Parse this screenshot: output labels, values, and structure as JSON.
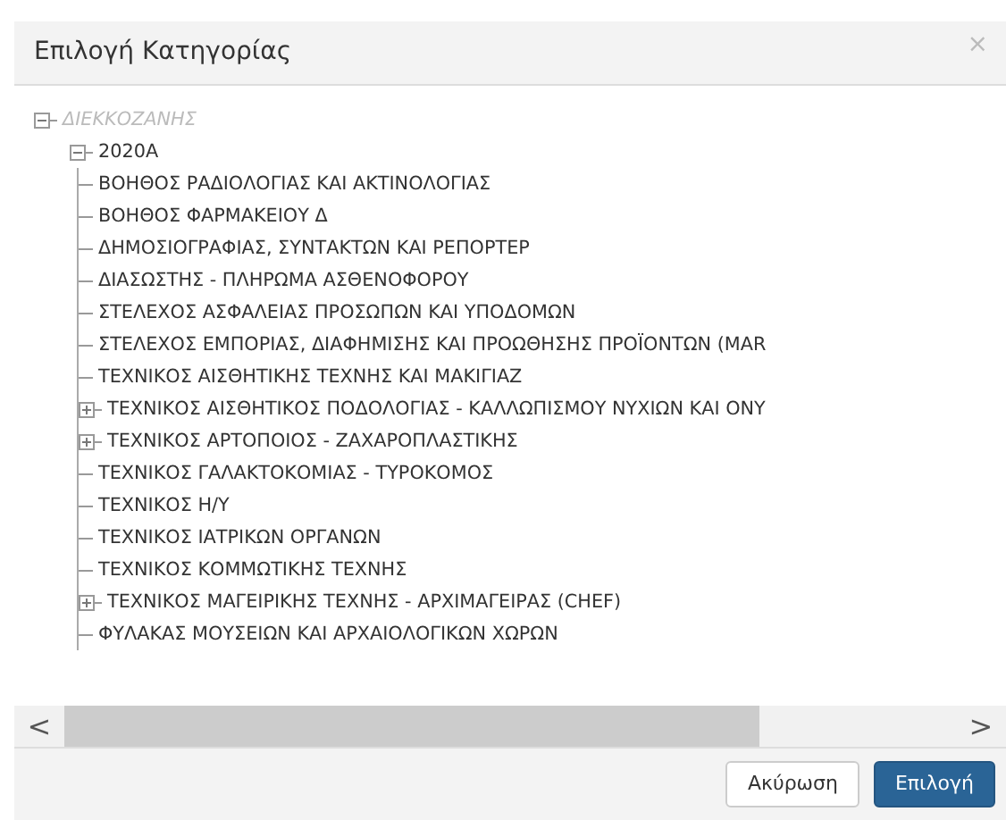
{
  "dialog": {
    "title": "Επιλογή Κατηγορίας",
    "close": "×"
  },
  "tree": [
    {
      "label": "ΔΙΕΚΚΟΖΑΝΗΣ",
      "disabled": true,
      "expanded": true,
      "children": [
        {
          "label": "2020A",
          "disabled": false,
          "expanded": true,
          "children": [
            {
              "label": "ΒΟΗΘΟΣ ΡΑΔΙΟΛΟΓΙΑΣ ΚΑΙ ΑΚΤΙΝΟΛΟΓΙΑΣ"
            },
            {
              "label": "ΒΟΗΘΟΣ ΦΑΡΜΑΚΕΙΟΥ Δ"
            },
            {
              "label": "ΔΗΜΟΣΙΟΓΡΑΦΙΑΣ, ΣΥΝΤΑΚΤΩΝ ΚΑΙ ΡΕΠΟΡΤΕΡ"
            },
            {
              "label": "ΔΙΑΣΩΣΤΗΣ - ΠΛΗΡΩΜΑ ΑΣΘΕΝΟΦΟΡΟΥ"
            },
            {
              "label": "ΣΤΕΛΕΧΟΣ ΑΣΦΑΛΕΙΑΣ ΠΡΟΣΩΠΩΝ ΚΑΙ ΥΠΟΔΟΜΩΝ"
            },
            {
              "label": "ΣΤΕΛΕΧΟΣ ΕΜΠΟΡΙΑΣ, ΔΙΑΦΗΜΙΣΗΣ ΚΑΙ ΠΡΟΩΘΗΣΗΣ ΠΡΟΪΟΝΤΩΝ (MAR"
            },
            {
              "label": "ΤΕΧΝΙΚΟΣ ΑΙΣΘΗΤΙΚΗΣ ΤΕΧΝΗΣ ΚΑΙ ΜΑΚΙΓΙΑΖ"
            },
            {
              "label": "ΤΕΧΝΙΚΟΣ ΑΙΣΘΗΤΙΚΟΣ ΠΟΔΟΛΟΓΙΑΣ - ΚΑΛΛΩΠΙΣΜΟΥ ΝΥΧΙΩΝ ΚΑΙ ΟΝΥ",
              "expanded": false
            },
            {
              "label": "ΤΕΧΝΙΚΟΣ ΑΡΤΟΠΟΙΟΣ - ΖΑΧΑΡΟΠΛΑΣΤΙΚΗΣ",
              "expanded": false
            },
            {
              "label": "ΤΕΧΝΙΚΟΣ ΓΑΛΑΚΤΟΚΟΜΙΑΣ - ΤΥΡΟΚΟΜΟΣ"
            },
            {
              "label": "ΤΕΧΝΙΚΟΣ Η/Υ"
            },
            {
              "label": "ΤΕΧΝΙΚΟΣ ΙΑΤΡΙΚΩΝ ΟΡΓΑΝΩΝ"
            },
            {
              "label": "ΤΕΧΝΙΚΟΣ ΚΟΜΜΩΤΙΚΗΣ ΤΕΧΝΗΣ"
            },
            {
              "label": "ΤΕΧΝΙΚΟΣ ΜΑΓΕΙΡΙΚΗΣ ΤΕΧΝΗΣ - ΑΡΧΙΜΑΓΕΙΡΑΣ (CHEF)",
              "expanded": false
            },
            {
              "label": "ΦΥΛΑΚΑΣ ΜΟΥΣΕΙΩΝ ΚΑΙ ΑΡΧΑΙΟΛΟΓΙΚΩΝ ΧΩΡΩΝ"
            }
          ]
        }
      ]
    }
  ],
  "scrollbar": {
    "left": "<",
    "right": ">"
  },
  "buttons": [
    {
      "label": "Ακύρωση",
      "kind": "secondary"
    },
    {
      "label": "Επιλογή",
      "kind": "primary"
    }
  ]
}
